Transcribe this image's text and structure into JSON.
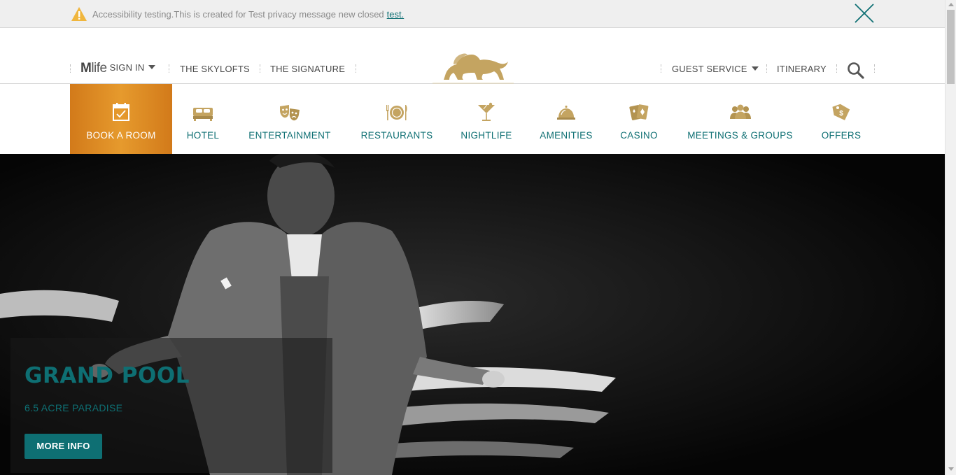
{
  "notice": {
    "message": "Accessibility testing.This is created for Test privacy message new closed",
    "link_text": "test.",
    "icons": {
      "warning": "warning-triangle-icon",
      "close": "close-x-icon"
    }
  },
  "utility_nav": {
    "mlife_logo_bold": "M",
    "mlife_logo_light": "life",
    "sign_in": "SIGN IN",
    "skylofts": "THE SKYLOFTS",
    "signature": "THE SIGNATURE",
    "guest_service": "GUEST SERVICE",
    "itinerary": "ITINERARY",
    "search_icon": "search-icon",
    "brand_logo": "lion-logo-icon"
  },
  "main_nav": {
    "items": [
      {
        "label": "BOOK A ROOM",
        "icon": "calendar-check-icon"
      },
      {
        "label": "HOTEL",
        "icon": "bed-icon"
      },
      {
        "label": "ENTERTAINMENT",
        "icon": "theater-masks-icon"
      },
      {
        "label": "RESTAURANTS",
        "icon": "plate-fork-knife-icon"
      },
      {
        "label": "NIGHTLIFE",
        "icon": "cocktail-glass-icon"
      },
      {
        "label": "AMENITIES",
        "icon": "service-bell-icon"
      },
      {
        "label": "CASINO",
        "icon": "playing-cards-icon"
      },
      {
        "label": "MEETINGS & GROUPS",
        "icon": "group-people-icon"
      },
      {
        "label": "OFFERS",
        "icon": "price-tag-icon"
      }
    ]
  },
  "hero": {
    "title": "GRAND POOL",
    "subtitle": "6.5 ACRE PARADISE",
    "button": "MORE INFO"
  },
  "colors": {
    "teal": "#0e6f73",
    "gold": "#c4a461",
    "orange": "#de8a22",
    "notice_bg": "#efefef"
  }
}
